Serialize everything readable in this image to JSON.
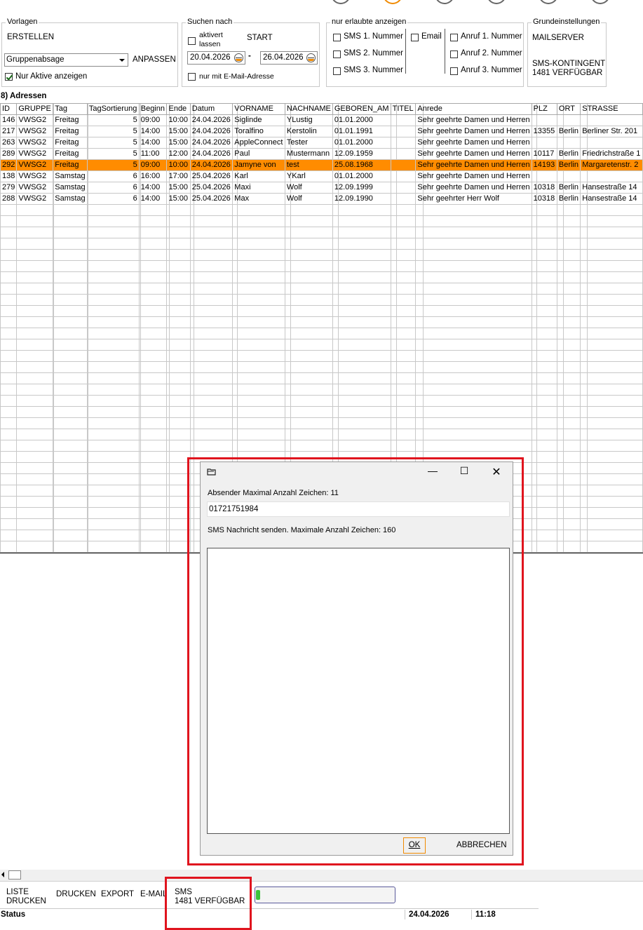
{
  "vorlagen": {
    "title": "Vorlagen",
    "erstellen": "ERSTELLEN",
    "select_value": "Gruppenabsage",
    "anpassen": "ANPASSEN",
    "nur_aktive": "Nur Aktive anzeigen"
  },
  "suchen": {
    "title": "Suchen nach",
    "aktiviert_line1": "aktivert",
    "aktiviert_line2": "lassen",
    "start": "START",
    "date_from": "20.04.2026",
    "dash": "-",
    "date_to": "26.04.2026",
    "nur_email": "nur mit E-Mail-Adresse"
  },
  "erlaubte": {
    "title": "nur erlaubte anzeigen",
    "sms1": "SMS 1. Nummer",
    "sms2": "SMS 2. Nummer",
    "sms3": "SMS 3. Nummer",
    "email": "Email",
    "anruf1": "Anruf 1. Nummer",
    "anruf2": "Anruf 2. Nummer",
    "anruf3": "Anruf 3. Nummer"
  },
  "grund": {
    "title": "Grundeinstellungen",
    "mailserver": "MAILSERVER",
    "kontingent_line1": "SMS-KONTINGENT",
    "kontingent_line2": "1481 VERFÜGBAR"
  },
  "grid": {
    "title": "8) Adressen",
    "columns": [
      "ID",
      "GRUPPE",
      "Tag",
      "TagSortierung",
      "Beginn",
      "Ende",
      "Datum",
      "VORNAME",
      "NACHNAME",
      "GEBOREN_AM",
      "TITEL",
      "Anrede",
      "PLZ",
      "ORT",
      "STRASSE"
    ],
    "rows": [
      [
        "146",
        "VWSG2",
        "Freitag",
        "5",
        "09:00",
        "10:00",
        "24.04.2026",
        "Siglinde",
        "YLustig",
        "01.01.2000",
        "",
        "Sehr geehrte Damen und Herren",
        "",
        "",
        ""
      ],
      [
        "217",
        "VWSG2",
        "Freitag",
        "5",
        "14:00",
        "15:00",
        "24.04.2026",
        "Toralfino",
        "Kerstolin",
        "01.01.1991",
        "",
        "Sehr geehrte Damen und Herren",
        "13355",
        "Berlin",
        "Berliner Str. 201"
      ],
      [
        "263",
        "VWSG2",
        "Freitag",
        "5",
        "14:00",
        "15:00",
        "24.04.2026",
        "AppleConnect",
        "Tester",
        "01.01.2000",
        "",
        "Sehr geehrte Damen und Herren",
        "",
        "",
        ""
      ],
      [
        "289",
        "VWSG2",
        "Freitag",
        "5",
        "11:00",
        "12:00",
        "24.04.2026",
        "Paul",
        "Mustermann",
        "12.09.1959",
        "",
        "Sehr geehrte Damen und Herren",
        "10117",
        "Berlin",
        "Friedrichstraße 1"
      ],
      [
        "292",
        "VWSG2",
        "Freitag",
        "5",
        "09:00",
        "10:00",
        "24.04.2026",
        "Jamyne von",
        "test",
        "25.08.1968",
        "",
        "Sehr geehrte Damen und Herren",
        "14193",
        "Berlin",
        "Margaretenstr. 2"
      ],
      [
        "138",
        "VWSG2",
        "Samstag",
        "6",
        "16:00",
        "17:00",
        "25.04.2026",
        "Karl",
        "YKarl",
        "01.01.2000",
        "",
        "Sehr geehrte Damen und Herren",
        "",
        "",
        ""
      ],
      [
        "279",
        "VWSG2",
        "Samstag",
        "6",
        "14:00",
        "15:00",
        "25.04.2026",
        "Maxi",
        "Wolf",
        "12.09.1999",
        "",
        "Sehr geehrte Damen und Herren",
        "10318",
        "Berlin",
        "Hansestraße 14"
      ],
      [
        "288",
        "VWSG2",
        "Samstag",
        "6",
        "14:00",
        "15:00",
        "25.04.2026",
        "Max",
        "Wolf",
        "12.09.1990",
        "",
        "Sehr geehrter Herr Wolf",
        "10318",
        "Berlin",
        "Hansestraße 14"
      ]
    ],
    "selected_row": 4
  },
  "dialog": {
    "absender_label": "Absender Maximal Anzahl Zeichen: 11",
    "absender_value": "01721751984",
    "nachricht_label": "SMS Nachricht senden. Maximale Anzahl Zeichen: 160",
    "nachricht_value": "",
    "ok": "OK",
    "abbrechen": "ABBRECHEN"
  },
  "toolbar": {
    "liste_line1": "LISTE",
    "liste_line2": "DRUCKEN",
    "drucken": "DRUCKEN",
    "export": "EXPORT",
    "email": "E-MAIL",
    "sms_line1": "SMS",
    "sms_line2": "1481 VERFÜGBAR"
  },
  "status": {
    "label": "Status",
    "date": "24.04.2026",
    "time": "11:18"
  },
  "progress": {
    "value": 0.02
  },
  "colors": {
    "accent": "#ff8c00",
    "highlight": "#e0141e",
    "progress": "#3cc43c"
  }
}
